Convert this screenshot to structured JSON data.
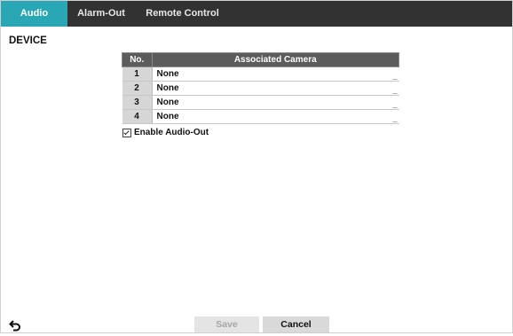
{
  "tabs": [
    {
      "label": "Audio",
      "active": true
    },
    {
      "label": "Alarm-Out",
      "active": false
    },
    {
      "label": "Remote Control",
      "active": false
    }
  ],
  "section": {
    "title": "DEVICE"
  },
  "table": {
    "headers": [
      "No.",
      "Associated Camera"
    ],
    "rows": [
      {
        "no": "1",
        "camera": "None"
      },
      {
        "no": "2",
        "camera": "None"
      },
      {
        "no": "3",
        "camera": "None"
      },
      {
        "no": "4",
        "camera": "None"
      }
    ]
  },
  "checkbox": {
    "label": "Enable Audio-Out",
    "checked": true
  },
  "buttons": {
    "save": "Save",
    "cancel": "Cancel"
  },
  "icons": {
    "back": "back-arrow-icon"
  },
  "colors": {
    "accent": "#2aa7b4",
    "tabbar": "#323232",
    "header": "#5c5c5c"
  }
}
